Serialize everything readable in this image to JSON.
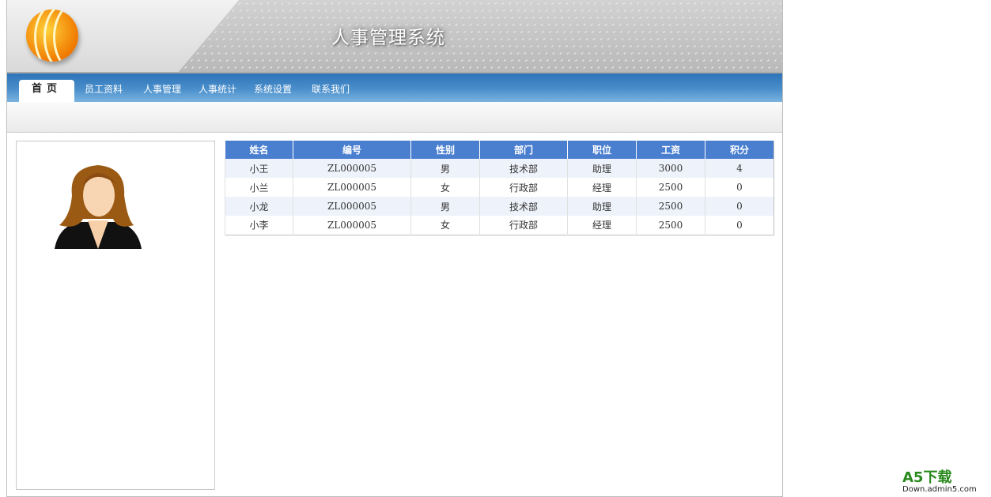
{
  "header": {
    "title": "人事管理系统"
  },
  "nav": {
    "tabs": [
      "首页",
      "员工资料",
      "人事管理",
      "人事统计",
      "系统设置",
      "联系我们"
    ]
  },
  "table": {
    "columns": [
      "姓名",
      "编号",
      "性别",
      "部门",
      "职位",
      "工资",
      "积分"
    ],
    "rows": [
      [
        "小王",
        "ZL000005",
        "男",
        "技术部",
        "助理",
        "3000",
        "4"
      ],
      [
        "小兰",
        "ZL000005",
        "女",
        "行政部",
        "经理",
        "2500",
        "0"
      ],
      [
        "小龙",
        "ZL000005",
        "男",
        "技术部",
        "助理",
        "2500",
        "0"
      ],
      [
        "小李",
        "ZL000005",
        "女",
        "行政部",
        "经理",
        "2500",
        "0"
      ]
    ]
  },
  "watermark": {
    "brand": "A5下载",
    "url": "Down.admin5.com"
  },
  "colors": {
    "nav": "#3a80c2",
    "table_header": "#4a7fd0"
  }
}
